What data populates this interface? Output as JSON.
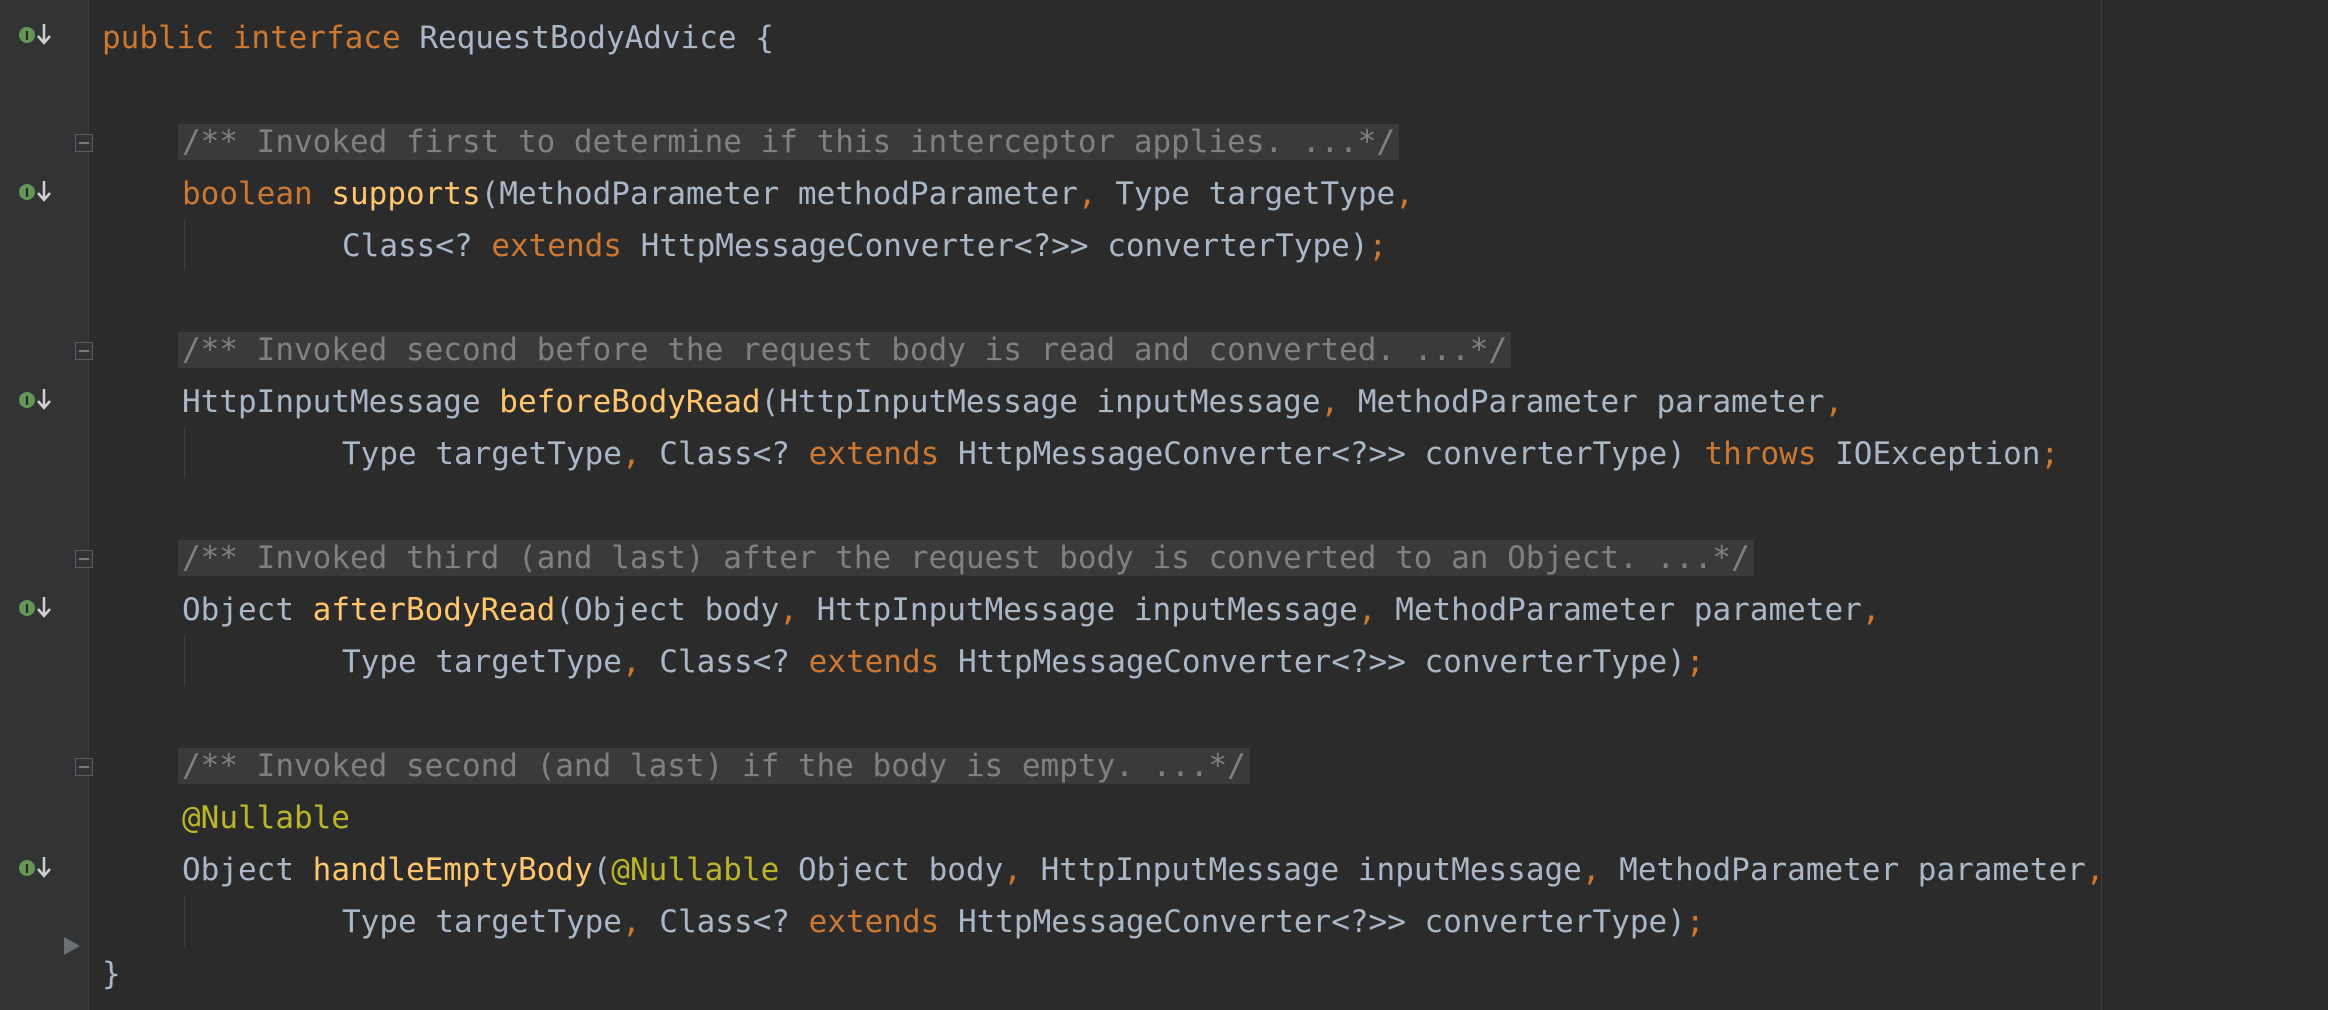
{
  "editor": {
    "lines": {
      "iface": {
        "kw1": "public",
        "kw2": "interface",
        "name": "RequestBodyAdvice",
        "brace": "{"
      },
      "c1": "/** Invoked first to determine if this interceptor applies. ...*/",
      "supports": {
        "ret": "boolean",
        "name": "supports",
        "p1": "(MethodParameter methodParameter",
        "comma": ",",
        "p2": " Type targetType",
        "comma2": ","
      },
      "supports_cont": {
        "a": "Class<? ",
        "ext": "extends",
        "b": " HttpMessageConverter<?>> converterType)",
        "semi": ";"
      },
      "c2": "/** Invoked second before the request body is read and converted. ...*/",
      "before": {
        "ret": "HttpInputMessage ",
        "name": "beforeBodyRead",
        "p1": "(HttpInputMessage inputMessage",
        "comma": ",",
        "p2": " MethodParameter parameter",
        "comma2": ","
      },
      "before_cont": {
        "a": "Type targetType",
        "comma": ",",
        "b": " Class<? ",
        "ext": "extends",
        "c": " HttpMessageConverter<?>> converterType) ",
        "throws": "throws",
        "d": " IOException",
        "semi": ";"
      },
      "c3": "/** Invoked third (and last) after the request body is converted to an Object. ...*/",
      "after": {
        "ret": "Object ",
        "name": "afterBodyRead",
        "p1": "(Object body",
        "comma": ",",
        "p2": " HttpInputMessage inputMessage",
        "comma2": ",",
        "p3": " MethodParameter parameter",
        "comma3": ","
      },
      "after_cont": {
        "a": "Type targetType",
        "comma": ",",
        "b": " Class<? ",
        "ext": "extends",
        "c": " HttpMessageConverter<?>> converterType)",
        "semi": ";"
      },
      "c4": "/** Invoked second (and last) if the body is empty. ...*/",
      "nullable": "@Nullable",
      "empty": {
        "ret": "Object ",
        "name": "handleEmptyBody",
        "paren": "(",
        "ann": "@Nullable",
        "p1": " Object body",
        "comma": ",",
        "p2": " HttpInputMessage inputMessage",
        "comma2": ",",
        "p3": " MethodParameter parameter",
        "comma3": ","
      },
      "empty_cont": {
        "a": "Type targetType",
        "comma": ",",
        "b": " Class<? ",
        "ext": "extends",
        "c": " HttpMessageConverter<?>> converterType)",
        "semi": ";"
      },
      "close": "}"
    },
    "icons": {
      "implemented": "implemented-interface-method-icon",
      "fold": "fold-toggle-icon"
    },
    "colors": {
      "background": "#2b2b2b",
      "keyword": "#cc7832",
      "method": "#ffc66d",
      "annotation": "#bbb529",
      "comment": "#808080",
      "text": "#a9b7c6",
      "gutter_icon": "#629755"
    }
  }
}
